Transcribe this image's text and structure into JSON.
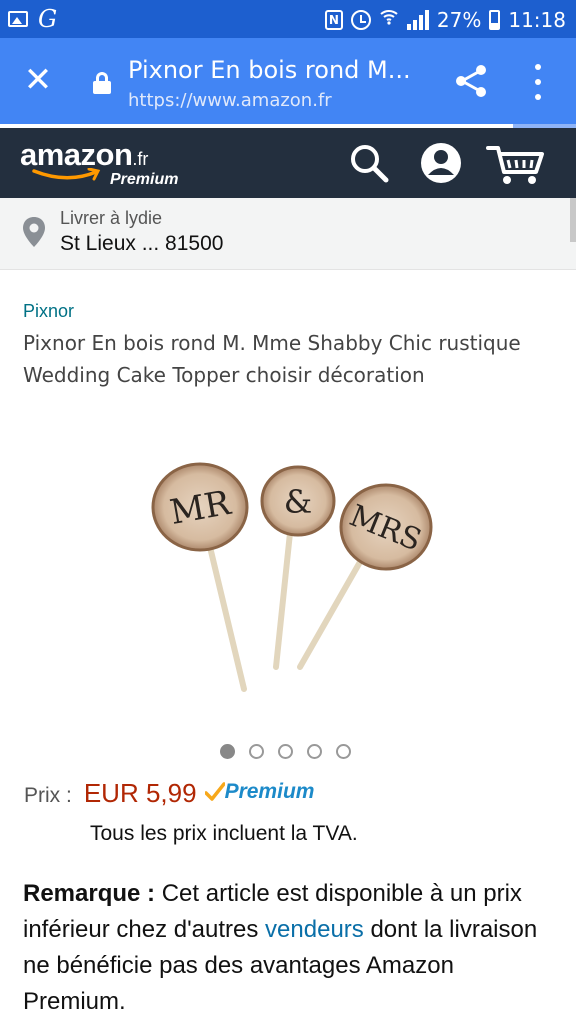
{
  "status_bar": {
    "notification_letter": "G",
    "battery": "27%",
    "time": "11:18",
    "icons": [
      "image-icon",
      "g-notification-icon",
      "nfc-icon",
      "alarm-icon",
      "wifi-icon",
      "signal-icon",
      "battery-icon"
    ]
  },
  "browser": {
    "page_title": "Pixnor En bois rond M. Mme Shabby Chic rustique Wedding Cake Topper choisir décoration",
    "title_display": "Pixnor En bois rond M...",
    "url": "https://www.amazon.fr",
    "close_icon": "close-icon",
    "load_progress": 0.89,
    "colors": {
      "toolbar": "#4285f4",
      "status_bar": "#1d5fcf"
    }
  },
  "amazon_header": {
    "logo_word": "amazon",
    "logo_tld": ".fr",
    "logo_tagline": "Premium",
    "icons": [
      "search-icon",
      "account-icon",
      "cart-icon"
    ],
    "colors": {
      "background": "#232f3e",
      "smile": "#ff9900"
    }
  },
  "delivery": {
    "line1": "Livrer à lydie",
    "line2": "St Lieux ... 81500"
  },
  "product": {
    "brand": "Pixnor",
    "title_line1": "Pixnor En bois rond M. Mme Shabby Chic rustique",
    "title_line2": "Wedding Cake Topper choisir décoration",
    "image_labels": [
      "MR",
      "&",
      "MRS"
    ],
    "image_count": 5,
    "active_image": 1,
    "price_label": "Prix :",
    "price": "EUR 5,99",
    "prime_label": "Premium",
    "vat_note": "Tous les prix incluent la TVA.",
    "colors": {
      "brand_link": "#007185",
      "price": "#b12704",
      "prime": "#1c8ac9"
    }
  },
  "remark": {
    "label": "Remarque :",
    "text_before_link": " Cet article est disponible à un prix inférieur chez d'autres ",
    "link_text": "vendeurs",
    "text_after_link": " dont la livraison ne bénéficie pas des avantages Amazon Premium."
  }
}
